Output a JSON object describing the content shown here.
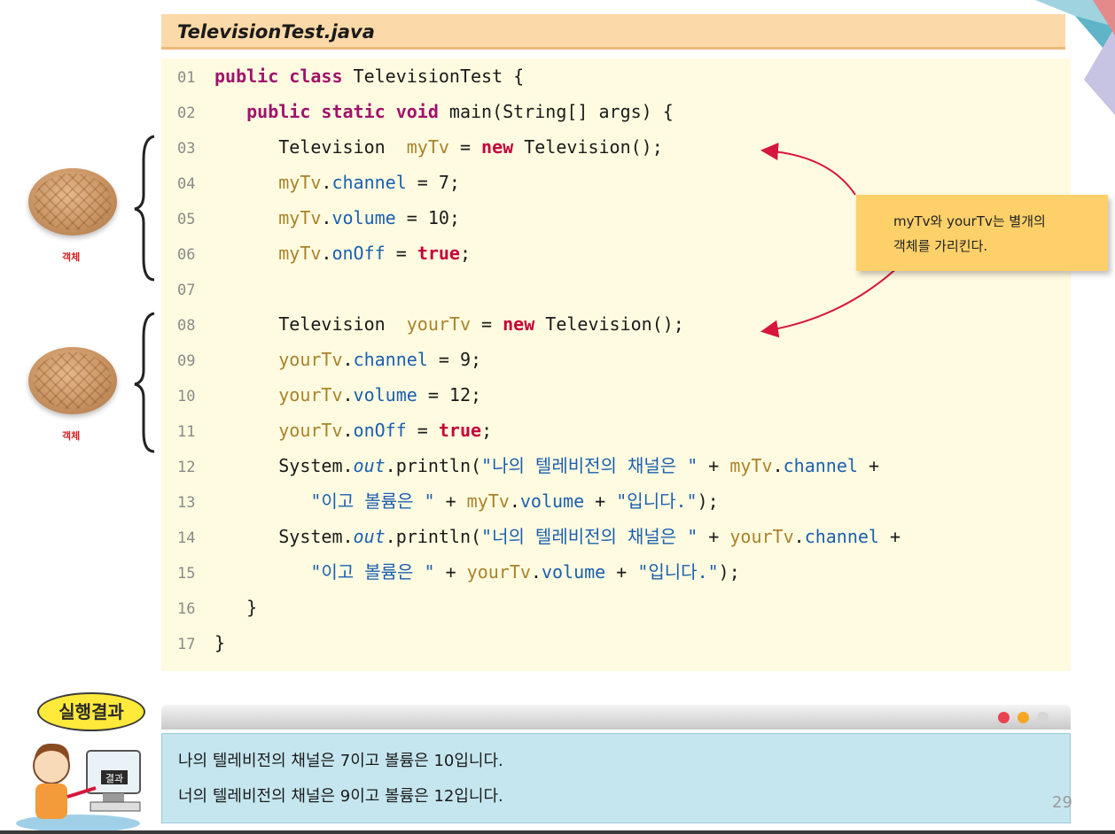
{
  "file_title": "TelevisionTest.java",
  "code_lines": [
    {
      "num": "01",
      "parts": [
        {
          "t": "public class",
          "c": "kw"
        },
        {
          "t": " TelevisionTest {"
        }
      ]
    },
    {
      "num": "02",
      "parts": [
        {
          "t": "   "
        },
        {
          "t": "public static void",
          "c": "kw"
        },
        {
          "t": " main(String[] args) {"
        }
      ]
    },
    {
      "num": "03",
      "parts": [
        {
          "t": "      Television  "
        },
        {
          "t": "myTv",
          "c": "var"
        },
        {
          "t": " = "
        },
        {
          "t": "new",
          "c": "kw2"
        },
        {
          "t": " Television();"
        }
      ]
    },
    {
      "num": "04",
      "parts": [
        {
          "t": "      "
        },
        {
          "t": "myTv",
          "c": "var"
        },
        {
          "t": "."
        },
        {
          "t": "channel",
          "c": "fld"
        },
        {
          "t": " = 7;"
        }
      ]
    },
    {
      "num": "05",
      "parts": [
        {
          "t": "      "
        },
        {
          "t": "myTv",
          "c": "var"
        },
        {
          "t": "."
        },
        {
          "t": "volume",
          "c": "fld"
        },
        {
          "t": " = 10;"
        }
      ]
    },
    {
      "num": "06",
      "parts": [
        {
          "t": "      "
        },
        {
          "t": "myTv",
          "c": "var"
        },
        {
          "t": "."
        },
        {
          "t": "onOff",
          "c": "fld"
        },
        {
          "t": " = "
        },
        {
          "t": "true",
          "c": "kw2"
        },
        {
          "t": ";"
        }
      ]
    },
    {
      "num": "07",
      "parts": []
    },
    {
      "num": "08",
      "parts": [
        {
          "t": "      Television  "
        },
        {
          "t": "yourTv",
          "c": "var"
        },
        {
          "t": " = "
        },
        {
          "t": "new",
          "c": "kw2"
        },
        {
          "t": " Television();"
        }
      ]
    },
    {
      "num": "09",
      "parts": [
        {
          "t": "      "
        },
        {
          "t": "yourTv",
          "c": "var"
        },
        {
          "t": "."
        },
        {
          "t": "channel",
          "c": "fld"
        },
        {
          "t": " = 9;"
        }
      ]
    },
    {
      "num": "10",
      "parts": [
        {
          "t": "      "
        },
        {
          "t": "yourTv",
          "c": "var"
        },
        {
          "t": "."
        },
        {
          "t": "volume",
          "c": "fld"
        },
        {
          "t": " = 12;"
        }
      ]
    },
    {
      "num": "11",
      "parts": [
        {
          "t": "      "
        },
        {
          "t": "yourTv",
          "c": "var"
        },
        {
          "t": "."
        },
        {
          "t": "onOff",
          "c": "fld"
        },
        {
          "t": " = "
        },
        {
          "t": "true",
          "c": "kw2"
        },
        {
          "t": ";"
        }
      ]
    },
    {
      "num": "12",
      "parts": [
        {
          "t": "      System."
        },
        {
          "t": "out",
          "c": "it"
        },
        {
          "t": ".println("
        },
        {
          "t": "\"나의 텔레비전의 채널은 \"",
          "c": "str"
        },
        {
          "t": " + "
        },
        {
          "t": "myTv",
          "c": "var"
        },
        {
          "t": "."
        },
        {
          "t": "channel",
          "c": "fld"
        },
        {
          "t": " +"
        }
      ]
    },
    {
      "num": "13",
      "parts": [
        {
          "t": "         "
        },
        {
          "t": "\"이고 볼륨은 \"",
          "c": "str"
        },
        {
          "t": " + "
        },
        {
          "t": "myTv",
          "c": "var"
        },
        {
          "t": "."
        },
        {
          "t": "volume",
          "c": "fld"
        },
        {
          "t": " + "
        },
        {
          "t": "\"입니다.\"",
          "c": "str"
        },
        {
          "t": ");"
        }
      ]
    },
    {
      "num": "14",
      "parts": [
        {
          "t": "      System."
        },
        {
          "t": "out",
          "c": "it"
        },
        {
          "t": ".println("
        },
        {
          "t": "\"너의 텔레비전의 채널은 \"",
          "c": "str"
        },
        {
          "t": " + "
        },
        {
          "t": "yourTv",
          "c": "var"
        },
        {
          "t": "."
        },
        {
          "t": "channel",
          "c": "fld"
        },
        {
          "t": " +"
        }
      ]
    },
    {
      "num": "15",
      "parts": [
        {
          "t": "         "
        },
        {
          "t": "\"이고 볼륨은 \"",
          "c": "str"
        },
        {
          "t": " + "
        },
        {
          "t": "yourTv",
          "c": "var"
        },
        {
          "t": "."
        },
        {
          "t": "volume",
          "c": "fld"
        },
        {
          "t": " + "
        },
        {
          "t": "\"입니다.\"",
          "c": "str"
        },
        {
          "t": ");"
        }
      ]
    },
    {
      "num": "16",
      "parts": [
        {
          "t": "   }"
        }
      ]
    },
    {
      "num": "17",
      "parts": [
        {
          "t": "}"
        }
      ]
    }
  ],
  "cookie_label": "객체",
  "callout": {
    "line1": "myTv와 yourTv는 별개의",
    "line2": "객체를 가리킨다."
  },
  "result_badge": "실행결과",
  "monitor_label": "결과",
  "output_lines": [
    "나의 텔레비전의 채널은 7이고 볼륨은 10입니다.",
    "너의 텔레비전의 채널은 9이고 볼륨은 12입니다."
  ],
  "page_number": "29",
  "colors": {
    "dot_red": "#e8434f",
    "dot_orange": "#f5a623",
    "dot_gray": "#d6d6d6"
  }
}
